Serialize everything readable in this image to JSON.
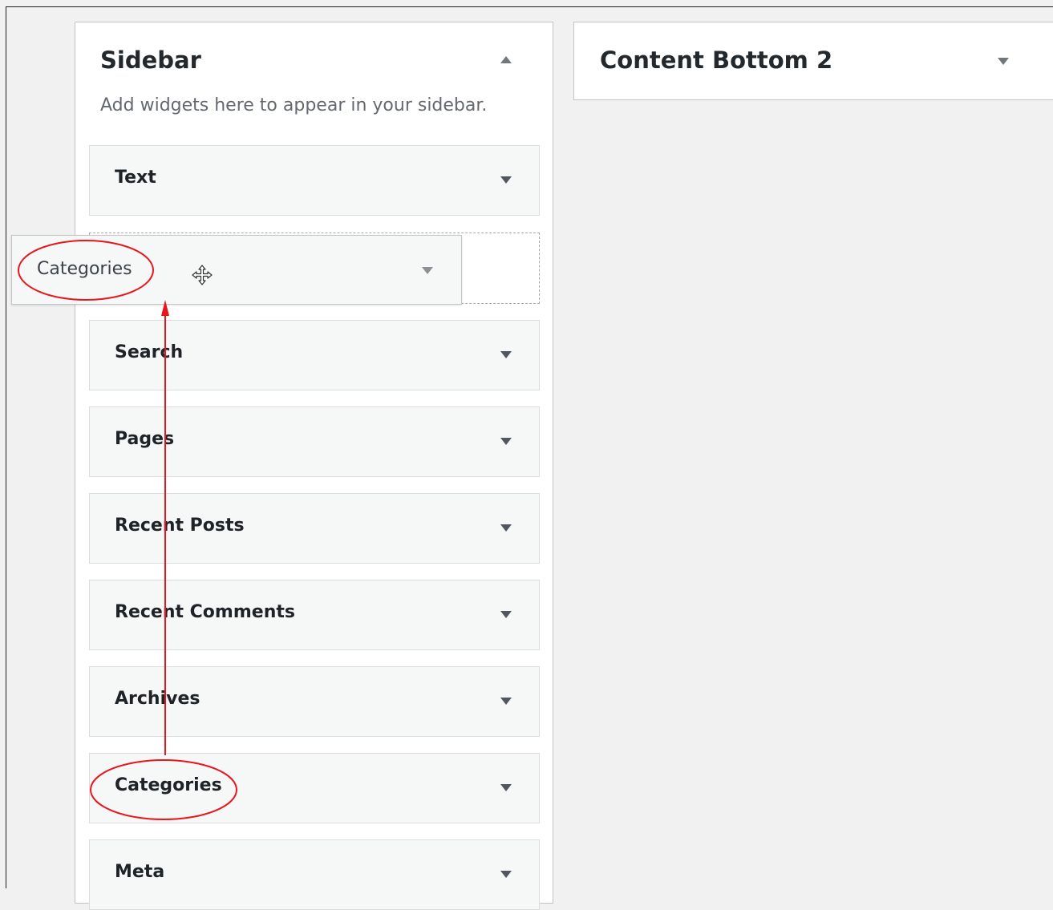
{
  "sidebar": {
    "title": "Sidebar",
    "description": "Add widgets here to appear in your sidebar.",
    "widgets": [
      {
        "label": "Text"
      },
      {
        "label": "Search"
      },
      {
        "label": "Pages"
      },
      {
        "label": "Recent Posts"
      },
      {
        "label": "Recent Comments"
      },
      {
        "label": "Archives"
      },
      {
        "label": "Categories"
      },
      {
        "label": "Meta"
      }
    ]
  },
  "dragging_widget": {
    "label": "Categories"
  },
  "content_bottom_2": {
    "title": "Content Bottom 2"
  },
  "icons": {
    "collapse": "triangle-up-icon",
    "expand": "triangle-down-icon",
    "move_cursor": "move-cursor-icon"
  },
  "annotation_color": "#e8151b"
}
